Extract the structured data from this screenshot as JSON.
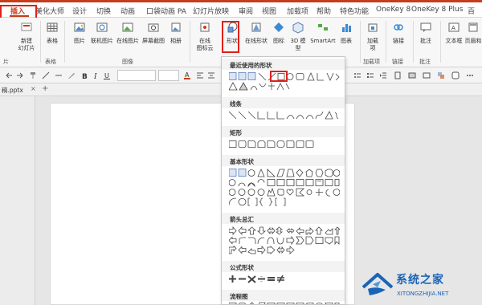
{
  "tabs": [
    "插入",
    "美化大师",
    "设计",
    "切换",
    "动画",
    "口袋动画 PA",
    "幻灯片放映",
    "审阅",
    "视图",
    "加载项",
    "帮助",
    "特色功能",
    "OneKey 8",
    "OneKey 8 Plus",
    "百"
  ],
  "active_tab_index": 0,
  "ribbon": {
    "buttons": [
      {
        "label": "新建",
        "label2": "幻灯片",
        "icon": "new-slide-icon"
      },
      {
        "label": "表格",
        "label2": "",
        "icon": "table-icon"
      },
      {
        "label": "图片",
        "label2": "",
        "icon": "picture-icon"
      },
      {
        "label": "联机图片",
        "label2": "",
        "icon": "online-picture-icon"
      },
      {
        "label": "在线图片",
        "label2": "",
        "icon": "online-image-icon"
      },
      {
        "label": "屏幕截图",
        "label2": "",
        "icon": "screenshot-icon"
      },
      {
        "label": "相册",
        "label2": "",
        "icon": "album-icon"
      },
      {
        "label": "在线",
        "label2": "图标云",
        "icon": "icon-cloud-icon"
      },
      {
        "label": "形状",
        "label2": "",
        "icon": "shapes-icon"
      },
      {
        "label": "在线形状",
        "label2": "",
        "icon": "online-shapes-icon"
      },
      {
        "label": "图标",
        "label2": "",
        "icon": "icons-icon"
      },
      {
        "label": "3D 模",
        "label2": "型",
        "icon": "3d-model-icon"
      },
      {
        "label": "SmartArt",
        "label2": "",
        "icon": "smartart-icon"
      },
      {
        "label": "图表",
        "label2": "",
        "icon": "chart-icon"
      },
      {
        "label": "加载",
        "label2": "项",
        "icon": "addin-icon"
      },
      {
        "label": "链接",
        "label2": "",
        "icon": "link-icon"
      },
      {
        "label": "批注",
        "label2": "",
        "icon": "comment-icon"
      },
      {
        "label": "文本框",
        "label2": "",
        "icon": "textbox-icon"
      },
      {
        "label": "页眉和",
        "label2": "",
        "icon": "header-icon"
      }
    ],
    "groups": [
      "片",
      "表格",
      "图像",
      "加载项",
      "链接",
      "批注"
    ]
  },
  "file_tab": "稿.pptx",
  "file_close": "×",
  "file_plus": "+",
  "dropdown": {
    "sections": [
      "最近使用的形状",
      "线条",
      "矩形",
      "基本形状",
      "箭头总汇",
      "公式形状",
      "流程图"
    ]
  },
  "watermark": {
    "main": "系统之家",
    "sub": "XITONGZHIJIA.NET"
  },
  "colors": {
    "accent": "#c43e1c",
    "highlight_box": "#e0201a",
    "watermark": "#1a64b7"
  }
}
